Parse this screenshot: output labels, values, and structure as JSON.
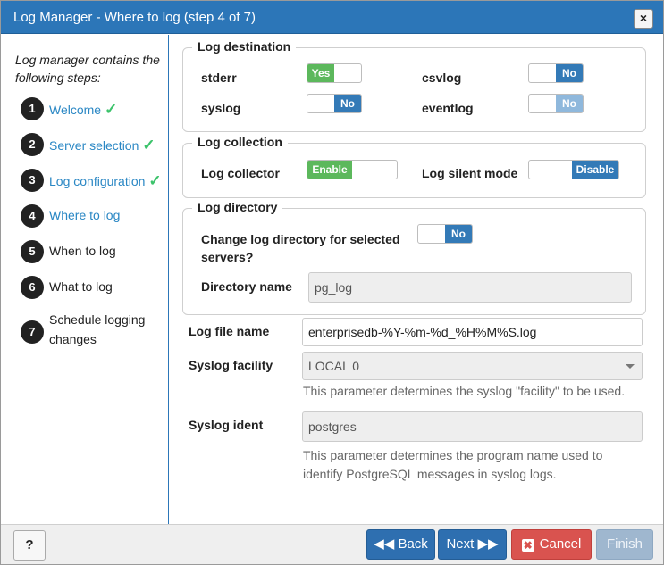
{
  "dialog": {
    "title": "Log Manager - Where to log (step 4 of 7)",
    "close_label": "×"
  },
  "sidebar": {
    "intro": "Log manager contains the following steps:",
    "steps": [
      {
        "num": "1",
        "label": "Welcome",
        "done": true,
        "active": true
      },
      {
        "num": "2",
        "label": "Server selection",
        "done": true,
        "active": true
      },
      {
        "num": "3",
        "label": "Log configuration",
        "done": true,
        "active": true
      },
      {
        "num": "4",
        "label": "Where to log",
        "done": false,
        "active": true
      },
      {
        "num": "5",
        "label": "When to log",
        "done": false,
        "active": false
      },
      {
        "num": "6",
        "label": "What to log",
        "done": false,
        "active": false
      },
      {
        "num": "7",
        "label": "Schedule logging changes",
        "done": false,
        "active": false
      }
    ],
    "check_glyph": "✓"
  },
  "log_destination": {
    "legend": "Log destination",
    "stderr": {
      "label": "stderr",
      "value": "Yes",
      "color": "#5cb85c"
    },
    "csvlog": {
      "label": "csvlog",
      "value": "No",
      "color": "#337ab7"
    },
    "syslog": {
      "label": "syslog",
      "value": "No",
      "color": "#337ab7"
    },
    "eventlog": {
      "label": "eventlog",
      "value": "No",
      "color": "#8fb8dc"
    }
  },
  "log_collection": {
    "legend": "Log collection",
    "collector": {
      "label": "Log collector",
      "value": "Enable",
      "color": "#5cb85c"
    },
    "silent_mode": {
      "label": "Log silent mode",
      "value": "Disable",
      "color": "#337ab7"
    }
  },
  "log_directory": {
    "legend": "Log directory",
    "change_label": "Change log directory for selected servers?",
    "change_value": "No",
    "directory_name_label": "Directory name",
    "directory_name_value": "pg_log"
  },
  "log_file": {
    "label": "Log file name",
    "value": "enterprisedb-%Y-%m-%d_%H%M%S.log"
  },
  "syslog_facility": {
    "label": "Syslog facility",
    "value": "LOCAL 0",
    "help": "This parameter determines the syslog \"facility\" to be used."
  },
  "syslog_ident": {
    "label": "Syslog ident",
    "value": "postgres",
    "help": "This parameter determines the program name used to identify PostgreSQL messages in syslog logs."
  },
  "footer": {
    "help_label": "?",
    "back_label": "◀◀ Back",
    "next_label": "Next ▶▶",
    "cancel_label": "Cancel",
    "cancel_icon": "✖",
    "finish_label": "Finish"
  }
}
